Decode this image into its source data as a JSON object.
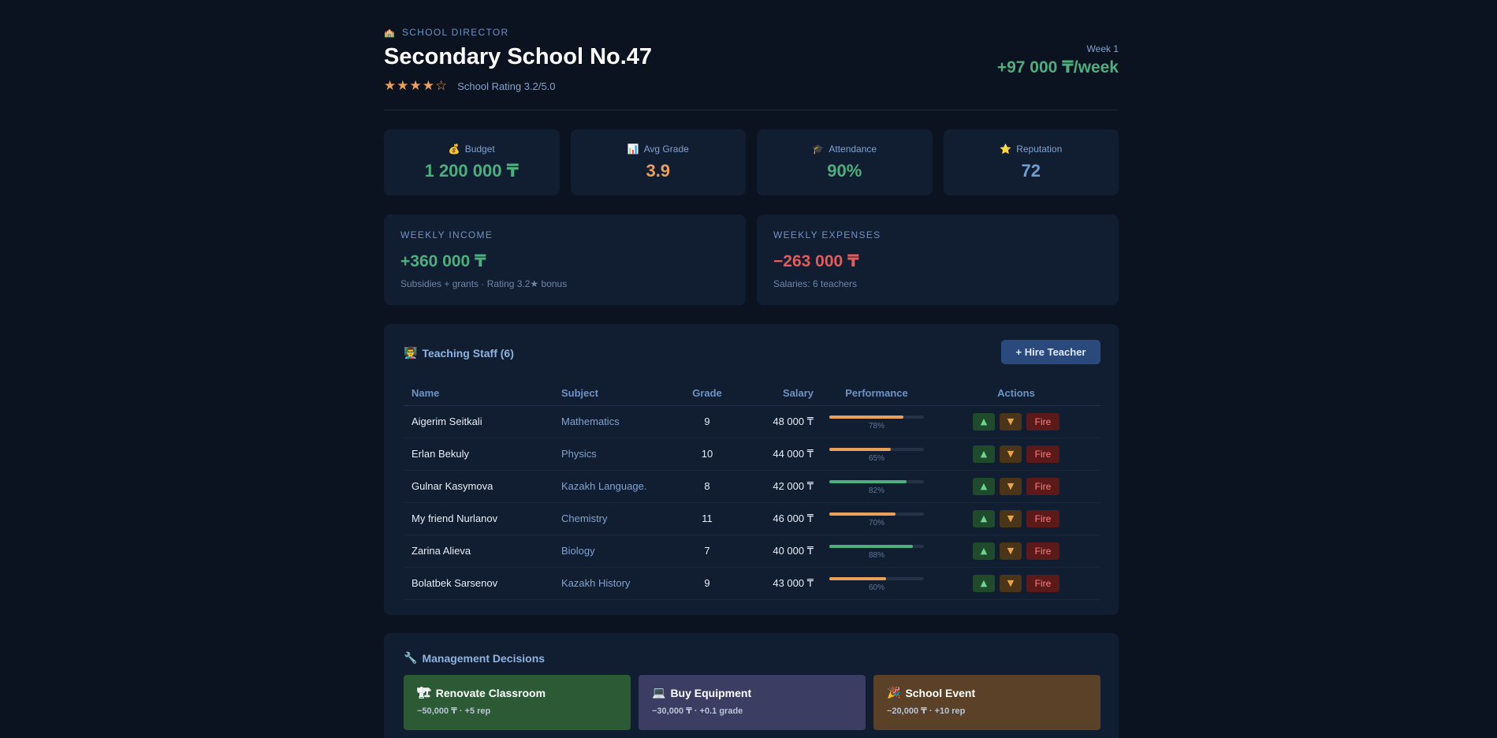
{
  "header": {
    "role_icon": "🏫",
    "role": "SCHOOL DIRECTOR",
    "title": "Secondary School No.47",
    "stars": "★★★★☆",
    "rating_text": "School Rating 3.2/5.0",
    "rating_value": 3.2,
    "week_label": "Week 1",
    "week_net": "+97 000 ₸/week"
  },
  "stats": [
    {
      "icon": "💰",
      "label": "Budget",
      "value": "1 200 000 ₸",
      "color": "#4caf7d"
    },
    {
      "icon": "📊",
      "label": "Avg Grade",
      "value": "3.9",
      "color": "#e8a05a"
    },
    {
      "icon": "🎓",
      "label": "Attendance",
      "value": "90%",
      "color": "#4caf7d"
    },
    {
      "icon": "⭐",
      "label": "Reputation",
      "value": "72",
      "color": "#6f9fd0"
    }
  ],
  "income": {
    "label": "WEEKLY INCOME",
    "value": "+360 000 ₸",
    "note": "Subsidies + grants · Rating 3.2★ bonus",
    "color": "#4caf7d"
  },
  "expenses": {
    "label": "WEEKLY EXPENSES",
    "value": "−263 000 ₸",
    "note": "Salaries: 6 teachers",
    "color": "#e55a5a"
  },
  "staff": {
    "icon": "👨‍🏫",
    "title": "Teaching Staff (6)",
    "hire_label": "+ Hire Teacher",
    "columns": [
      "Name",
      "Subject",
      "Grade",
      "Salary",
      "Performance",
      "Actions"
    ],
    "up_label": "▲",
    "down_label": "▼",
    "fire_label": "Fire",
    "rows": [
      {
        "name": "Aigerim Seitkali",
        "subject": "Mathematics",
        "grade": "9",
        "salary": "48 000 ₸",
        "perf": 78,
        "perf_label": "78%",
        "perf_color": "#e8a05a"
      },
      {
        "name": "Erlan Bekuly",
        "subject": "Physics",
        "grade": "10",
        "salary": "44 000 ₸",
        "perf": 65,
        "perf_label": "65%",
        "perf_color": "#e8a05a"
      },
      {
        "name": "Gulnar Kasymova",
        "subject": "Kazakh Language.",
        "grade": "8",
        "salary": "42 000 ₸",
        "perf": 82,
        "perf_label": "82%",
        "perf_color": "#4caf7d"
      },
      {
        "name": "My friend Nurlanov",
        "subject": "Chemistry",
        "grade": "11",
        "salary": "46 000 ₸",
        "perf": 70,
        "perf_label": "70%",
        "perf_color": "#e8a05a"
      },
      {
        "name": "Zarina Alieva",
        "subject": "Biology",
        "grade": "7",
        "salary": "40 000 ₸",
        "perf": 88,
        "perf_label": "88%",
        "perf_color": "#4caf7d"
      },
      {
        "name": "Bolatbek Sarsenov",
        "subject": "Kazakh History",
        "grade": "9",
        "salary": "43 000 ₸",
        "perf": 60,
        "perf_label": "60%",
        "perf_color": "#e8a05a"
      }
    ]
  },
  "management": {
    "icon": "🔧",
    "title": "Management Decisions",
    "cards": [
      {
        "icon": "🏗",
        "title": "Renovate Classroom",
        "sub": "−50,000 ₸ · +5 rep",
        "bg": "#2b5a35"
      },
      {
        "icon": "💻",
        "title": "Buy Equipment",
        "sub": "−30,000 ₸ · +0.1 grade",
        "bg": "#3b3d63"
      },
      {
        "icon": "🎉",
        "title": "School Event",
        "sub": "−20,000 ₸ · +10 rep",
        "bg": "#5a4128"
      }
    ]
  }
}
